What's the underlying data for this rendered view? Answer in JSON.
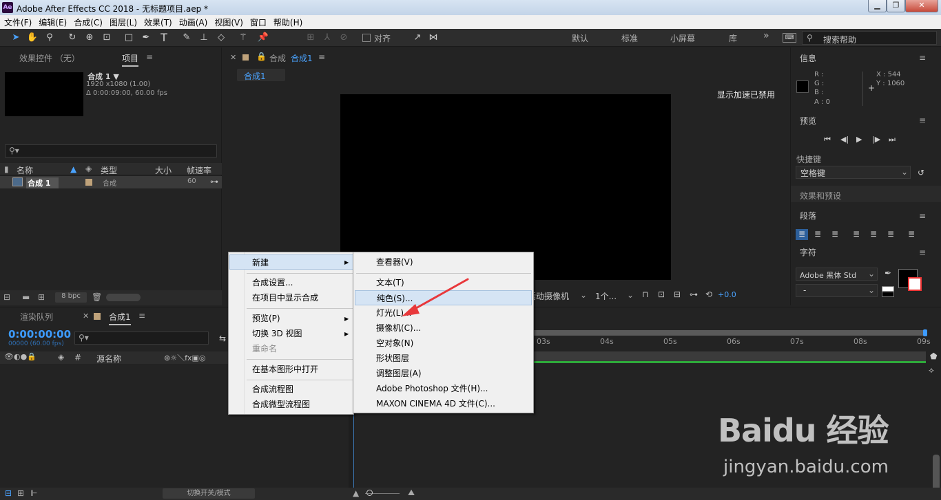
{
  "window": {
    "title": "Adobe After Effects CC 2018 - 无标题项目.aep *",
    "app_icon": "Ae"
  },
  "menubar": [
    "文件(F)",
    "编辑(E)",
    "合成(C)",
    "图层(L)",
    "效果(T)",
    "动画(A)",
    "视图(V)",
    "窗口",
    "帮助(H)"
  ],
  "toolbar": {
    "align_label": "对齐",
    "workspaces": [
      "默认",
      "标准",
      "小屏幕",
      "库"
    ],
    "more": "»",
    "search_placeholder": "搜索帮助"
  },
  "project_panel": {
    "tabs": [
      "效果控件 （无）",
      "项目"
    ],
    "comp_name": "合成 1 ▼",
    "comp_res": "1920 x1080 (1.00)",
    "comp_dur": "Δ 0:00:09:00, 60.00 fps",
    "columns": [
      "名称",
      "类型",
      "大小",
      "帧速率"
    ],
    "items": [
      {
        "name": "合成 1",
        "type": "合成",
        "fps": "60"
      }
    ],
    "bpc": "8 bpc"
  },
  "comp_panel": {
    "tab_label": "合成",
    "tab_name": "合成1",
    "sub_tab": "合成1",
    "gpu_notice": "显示加速已禁用",
    "camera": "活动摄像机",
    "views": "1个...",
    "exposure": "+0.0"
  },
  "right_panels": {
    "info": {
      "title": "信息",
      "r": "R :",
      "g": "G :",
      "b": "B :",
      "a": "A : 0",
      "x": "X : 544",
      "y": "Y : 1060"
    },
    "preview": {
      "title": "预览",
      "shortcut_label": "快捷键",
      "shortcut_value": "空格键"
    },
    "effects": {
      "title": "效果和预设"
    },
    "paragraph": {
      "title": "段落"
    },
    "character": {
      "title": "字符",
      "font": "Adobe 黑体 Std",
      "style": "-"
    }
  },
  "timeline": {
    "render_tab": "渲染队列",
    "comp_tab": "合成1",
    "timecode": "0:00:00:00",
    "frames": "00000 (60.00 fps)",
    "col_source": "源名称",
    "ticks": [
      "03s",
      "04s",
      "05s",
      "06s",
      "07s",
      "08s",
      "09s"
    ],
    "footer": "切换开关/模式"
  },
  "context_menu": {
    "items": [
      "新建",
      "合成设置...",
      "在项目中显示合成",
      "预览(P)",
      "切换 3D 视图",
      "重命名",
      "在基本图形中打开",
      "合成流程图",
      "合成微型流程图"
    ]
  },
  "submenu": {
    "items": [
      "查看器(V)",
      "文本(T)",
      "纯色(S)...",
      "灯光(L)...",
      "摄像机(C)...",
      "空对象(N)",
      "形状图层",
      "调整图层(A)",
      "Adobe Photoshop 文件(H)...",
      "MAXON CINEMA 4D 文件(C)..."
    ]
  },
  "watermark": {
    "brand": "Baidu 经验",
    "url": "jingyan.baidu.com"
  },
  "colors": {
    "accent": "#2d8ceb",
    "menu_bg": "#f0f0f0",
    "arrow": "#e8383b"
  }
}
